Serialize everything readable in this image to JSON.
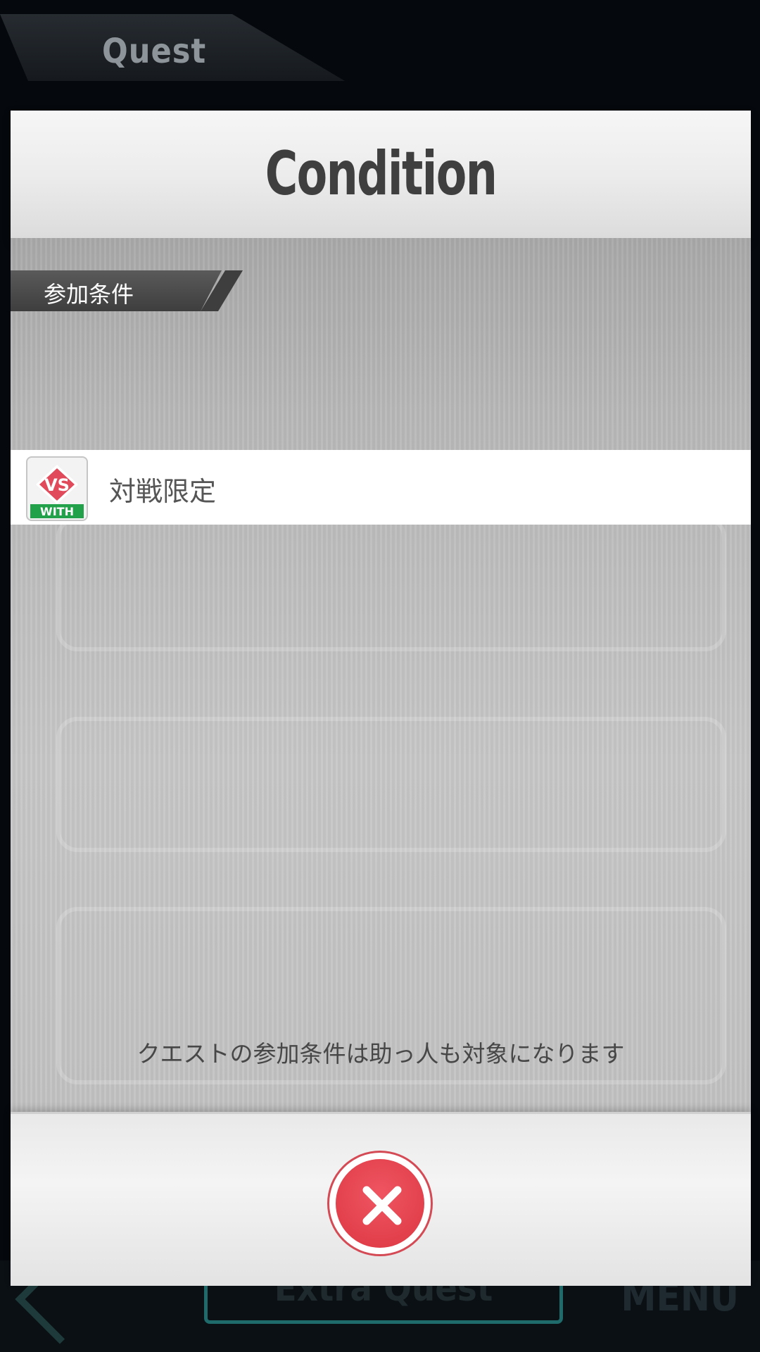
{
  "background": {
    "quest_title": "Quest",
    "extra_button": "Extra Quest",
    "menu_button": "MENU"
  },
  "modal": {
    "title": "Condition",
    "section_label": "参加条件",
    "condition": {
      "icon_top": "VS",
      "icon_bottom": "WITH",
      "text": "対戦限定"
    },
    "footnote": "クエストの参加条件は助っ人も対象になります",
    "close_icon": "close-x"
  },
  "colors": {
    "close_red": "#e0404a",
    "vs_red": "#e04a5a",
    "with_green": "#22a04a"
  }
}
